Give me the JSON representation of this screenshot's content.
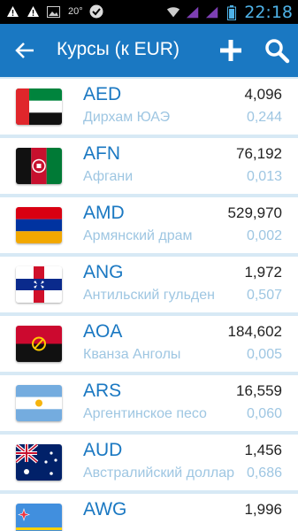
{
  "status_bar": {
    "temperature": "20°",
    "time": "22:18"
  },
  "action_bar": {
    "title": "Курсы (к EUR)",
    "back_icon": "arrow-back-icon",
    "add_icon": "plus-icon",
    "search_icon": "search-icon"
  },
  "colors": {
    "accent": "#1a78c2",
    "secondary_text": "#9ec6e2",
    "list_bg": "#d7e9f5"
  },
  "currencies": [
    {
      "code": "AED",
      "name": "Дирхам ЮАЭ",
      "rate": "4,096",
      "inverse": "0,244"
    },
    {
      "code": "AFN",
      "name": "Афгани",
      "rate": "76,192",
      "inverse": "0,013"
    },
    {
      "code": "AMD",
      "name": "Армянский драм",
      "rate": "529,970",
      "inverse": "0,002"
    },
    {
      "code": "ANG",
      "name": "Антильский гульден",
      "rate": "1,972",
      "inverse": "0,507"
    },
    {
      "code": "AOA",
      "name": "Кванза Анголы",
      "rate": "184,602",
      "inverse": "0,005"
    },
    {
      "code": "ARS",
      "name": "Аргентинское песо",
      "rate": "16,559",
      "inverse": "0,060"
    },
    {
      "code": "AUD",
      "name": "Австралийский доллар",
      "rate": "1,456",
      "inverse": "0,686"
    },
    {
      "code": "AWG",
      "name": "",
      "rate": "1,996",
      "inverse": ""
    }
  ]
}
